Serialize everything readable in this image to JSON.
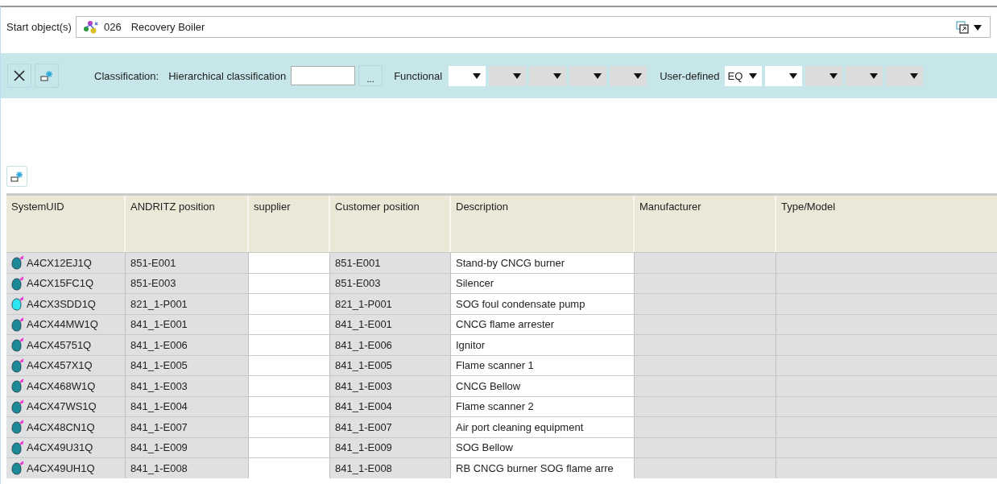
{
  "start_object": {
    "label": "Start object(s)",
    "code": "026",
    "name": "Recovery Boiler"
  },
  "filter_bar": {
    "classification_label": "Classification:",
    "hierarchical_label": "Hierarchical classification",
    "browse": "...",
    "functional_label": "Functional",
    "functional_dropdowns": [
      {
        "disabled": false
      },
      {
        "disabled": true
      },
      {
        "disabled": true
      },
      {
        "disabled": true
      },
      {
        "disabled": true
      }
    ],
    "user_defined_label": "User-defined",
    "user_defined_dropdowns": [
      {
        "value": "EQ",
        "disabled": false
      },
      {
        "disabled": false
      },
      {
        "disabled": true
      },
      {
        "disabled": true
      },
      {
        "disabled": true
      }
    ]
  },
  "table": {
    "columns": [
      "SystemUID",
      "ANDRITZ position",
      "supplier",
      "Customer position",
      "Description",
      "Manufacturer",
      "Type/Model"
    ],
    "rows": [
      {
        "color": "#1b8a96",
        "system_uid": "A4CX12EJ1Q",
        "andritz_position": "851-E001",
        "customer_position": "851-E001",
        "description": "Stand-by CNCG burner"
      },
      {
        "color": "#1b8a96",
        "system_uid": "A4CX15FC1Q",
        "andritz_position": "851-E003",
        "customer_position": "851-E003",
        "description": "Silencer"
      },
      {
        "color": "#2ee6f2",
        "system_uid": "A4CX3SDD1Q",
        "andritz_position": "821_1-P001",
        "customer_position": "821_1-P001",
        "description": "SOG foul condensate pump"
      },
      {
        "color": "#1b8a96",
        "system_uid": "A4CX44MW1Q",
        "andritz_position": "841_1-E001",
        "customer_position": "841_1-E001",
        "description": "CNCG flame arrester"
      },
      {
        "color": "#1b8a96",
        "system_uid": "A4CX45751Q",
        "andritz_position": "841_1-E006",
        "customer_position": "841_1-E006",
        "description": "Ignitor"
      },
      {
        "color": "#1b8a96",
        "system_uid": "A4CX457X1Q",
        "andritz_position": "841_1-E005",
        "customer_position": "841_1-E005",
        "description": "Flame scanner 1"
      },
      {
        "color": "#1b8a96",
        "system_uid": "A4CX468W1Q",
        "andritz_position": "841_1-E003",
        "customer_position": "841_1-E003",
        "description": "CNCG Bellow"
      },
      {
        "color": "#1b8a96",
        "system_uid": "A4CX47WS1Q",
        "andritz_position": "841_1-E004",
        "customer_position": "841_1-E004",
        "description": "Flame scanner 2"
      },
      {
        "color": "#1b8a96",
        "system_uid": "A4CX48CN1Q",
        "andritz_position": "841_1-E007",
        "customer_position": "841_1-E007",
        "description": "Air port cleaning equipment"
      },
      {
        "color": "#1b8a96",
        "system_uid": "A4CX49U31Q",
        "andritz_position": "841_1-E009",
        "customer_position": "841_1-E009",
        "description": "SOG Bellow"
      },
      {
        "color": "#1b8a96",
        "system_uid": "A4CX49UH1Q",
        "andritz_position": "841_1-E008",
        "customer_position": "841_1-E008",
        "description": "RB CNCG burner SOG flame arre"
      }
    ]
  }
}
